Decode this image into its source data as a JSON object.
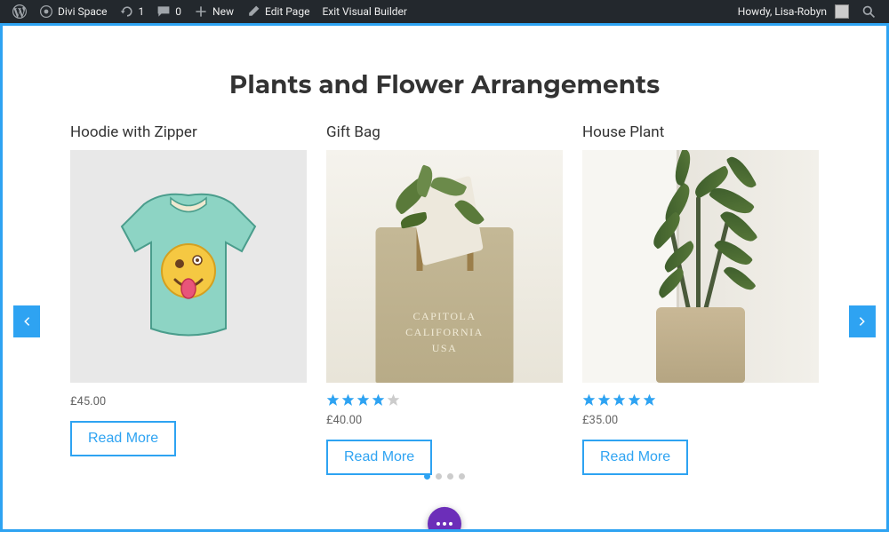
{
  "adminbar": {
    "site_name": "Divi Space",
    "updates_count": "1",
    "comments_count": "0",
    "new_label": "New",
    "edit_page_label": "Edit Page",
    "exit_builder_label": "Exit Visual Builder",
    "greeting": "Howdy, Lisa-Robyn"
  },
  "section": {
    "title": "Plants and Flower Arrangements"
  },
  "products": [
    {
      "title": "Hoodie with Zipper",
      "price": "£45.00",
      "rating": 0,
      "button": "Read More"
    },
    {
      "title": "Gift Bag",
      "price": "£40.00",
      "rating": 4,
      "button": "Read More",
      "bag_text_1": "CAPITOLA",
      "bag_text_2": "CALIFORNIA",
      "bag_text_3": "USA"
    },
    {
      "title": "House Plant",
      "price": "£35.00",
      "rating": 5,
      "button": "Read More"
    }
  ],
  "carousel": {
    "active_dot": 0,
    "total_dots": 4
  }
}
